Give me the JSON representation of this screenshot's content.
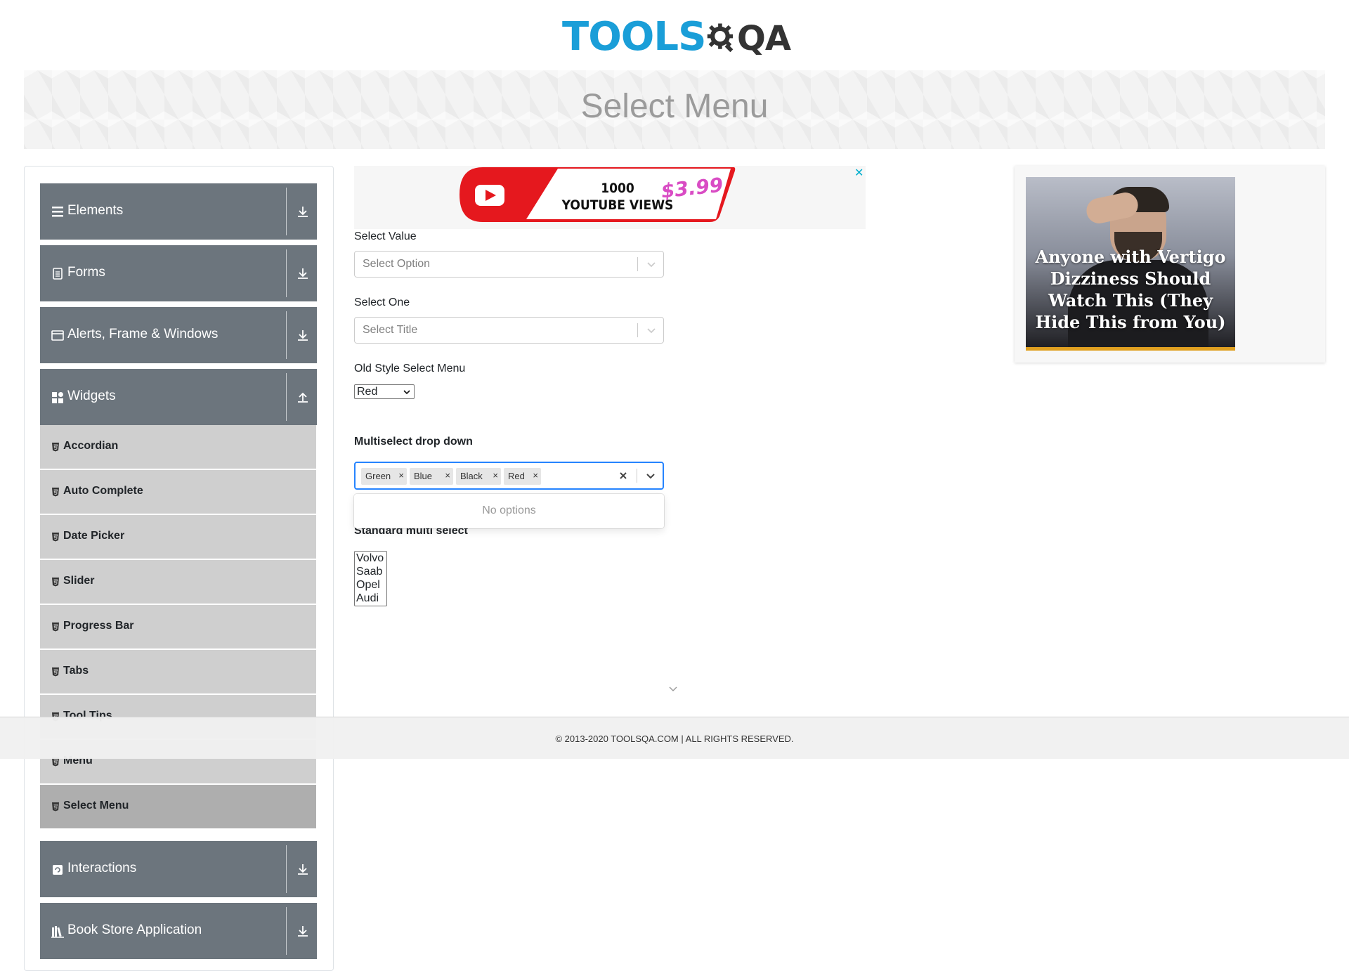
{
  "header": {
    "logo_text_blue": "TOOLS",
    "logo_text_dark": "QA",
    "page_title": "Select Menu"
  },
  "sidebar": {
    "groups": {
      "elements": "Elements",
      "forms": "Forms",
      "alerts": "Alerts, Frame & Windows",
      "widgets": "Widgets",
      "interactions": "Interactions",
      "bookstore": "Book Store Application"
    },
    "widget_items": [
      "Accordian",
      "Auto Complete",
      "Date Picker",
      "Slider",
      "Progress Bar",
      "Tabs",
      "Tool Tips",
      "Menu",
      "Select Menu"
    ],
    "active_item": "Select Menu"
  },
  "top_ad": {
    "line1": "1000",
    "line2": "YOUTUBE VIEWS",
    "price": "$3.99",
    "close": "✕"
  },
  "form": {
    "select_value_label": "Select Value",
    "select_value_placeholder": "Select Option",
    "select_one_label": "Select One",
    "select_one_placeholder": "Select Title",
    "old_style_label": "Old Style Select Menu",
    "old_style_value": "Red",
    "multiselect_label": "Multiselect drop down",
    "multiselect_chips": [
      "Green",
      "Blue",
      "Black",
      "Red"
    ],
    "multiselect_menu_text": "No options",
    "standard_multi_label": "Standard multi select",
    "standard_multi_options": [
      "Volvo",
      "Saab",
      "Opel",
      "Audi"
    ]
  },
  "right_ad": {
    "caption": "Anyone with Vertigo Dizziness Should Watch This (They Hide This from You)"
  },
  "footer": {
    "text": "© 2013-2020 TOOLSQA.COM | ALL RIGHTS RESERVED."
  },
  "colors": {
    "brand_blue": "#1a9ed8",
    "sidebar_group": "#6c757d",
    "sidebar_item": "#cfcfcf",
    "sidebar_active": "#aeaeae",
    "focus_border": "#2684ff"
  },
  "icons": [
    "hamburger-icon",
    "clipboard-icon",
    "window-icon",
    "widgets-grid-icon",
    "interactions-icon",
    "books-icon",
    "download-arrow-icon",
    "upload-arrow-icon",
    "chevron-down-icon",
    "close-icon"
  ]
}
